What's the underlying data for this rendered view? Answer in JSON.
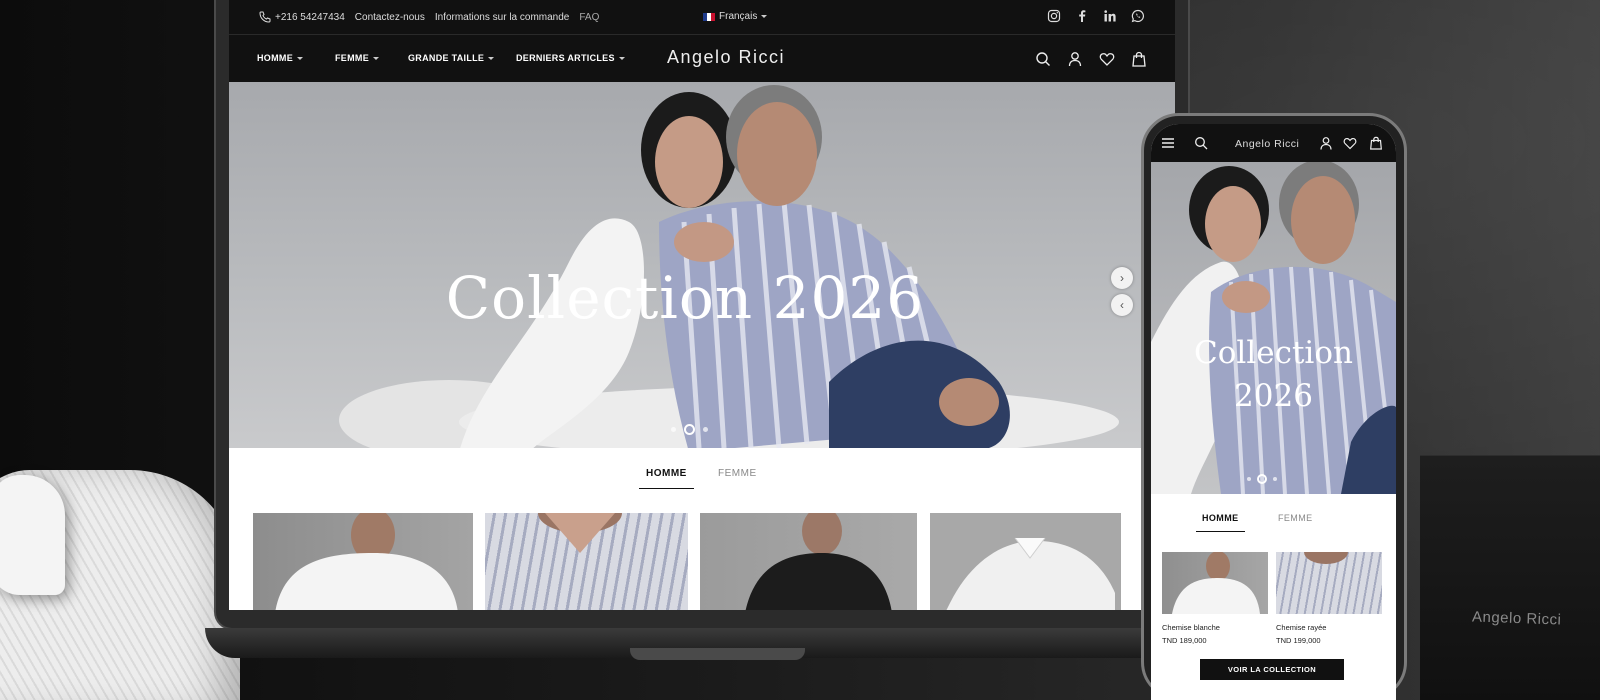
{
  "laptop_site": {
    "topbar": {
      "phone": "+216 54247434",
      "links": [
        "Contactez-nous",
        "Informations sur la commande",
        "FAQ"
      ],
      "language": "Français",
      "social_icons": [
        "instagram-icon",
        "facebook-icon",
        "linkedin-icon",
        "whatsapp-icon"
      ]
    },
    "nav": {
      "items": [
        "HOMME",
        "FEMME",
        "GRANDE TAILLE",
        "DERNIERS ARTICLES"
      ],
      "brand": "Angelo Ricci",
      "icons": [
        "search-icon",
        "user-icon",
        "heart-icon",
        "bag-icon"
      ]
    },
    "hero": {
      "title": "Collection 2026",
      "next_arrow": "›",
      "prev_arrow": "‹",
      "slides": 3,
      "active_slide": 2
    },
    "tabs": [
      "HOMME",
      "FEMME"
    ],
    "active_tab": "HOMME",
    "products": [
      "white-shirt-model",
      "striped-shirt-collar",
      "black-shirt-model",
      "folded-white-shirt"
    ]
  },
  "phone_site": {
    "brand": "Angelo Ricci",
    "hero_title_line1": "Collection",
    "hero_title_line2": "2026",
    "tabs": [
      "HOMME",
      "FEMME"
    ],
    "products": [
      {
        "name": "Chemise blanche",
        "price": "TND 189,000"
      },
      {
        "name": "Chemise rayée",
        "price": "TND 199,000"
      }
    ],
    "cta": "VOIR LA COLLECTION"
  },
  "box_brand": "Angelo Ricci",
  "colors": {
    "header_bg": "#111111",
    "hero_bg": "#b0b2b5",
    "accent_stripe": "#a6abc0",
    "cta_bg": "#111111"
  }
}
